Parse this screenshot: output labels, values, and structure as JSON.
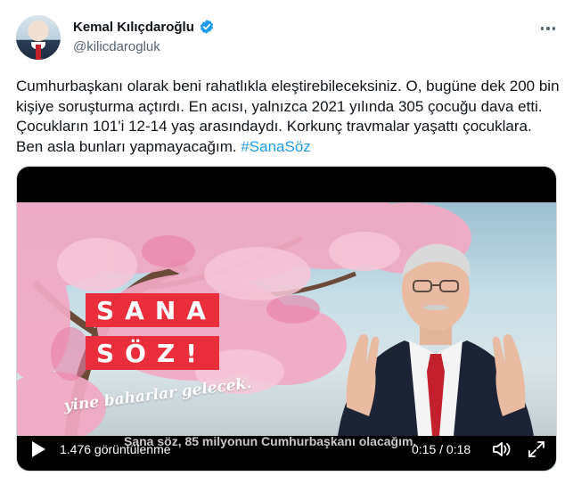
{
  "author": {
    "display_name": "Kemal Kılıçdaroğlu",
    "handle": "@kilicdarogluk",
    "verified": true
  },
  "tweet": {
    "text_main": "Cumhurbaşkanı olarak beni rahatlıkla eleştirebileceksiniz. O, bugüne dek 200 bin kişiye soruşturma açtırdı. En acısı, yalnızca 2021 yılında 305 çocuğu dava etti. Çocukların 101'i 12-14 yaş arasındaydı. Korkunç travmalar yaşattı çocuklara. Ben asla bunları yapmayacağım.",
    "hashtag": "#SanaSöz"
  },
  "video": {
    "overlay_line1": "SANA",
    "overlay_line2": "SÖZ!",
    "overlay_tagline": "yine baharlar gelecek.",
    "subtitle": "Sana söz, 85 milyonun Cumhurbaşkanı olacağım.",
    "views": "1.476 görüntülenme",
    "time": "0:15 / 0:18",
    "progress_fraction": 0.833
  },
  "icons": {
    "verified": "verified-badge-icon",
    "more": "more-options-icon",
    "play": "play-icon",
    "volume": "volume-icon",
    "fullscreen": "fullscreen-icon"
  },
  "colors": {
    "accent": "#1d9bf0",
    "overlay_red": "#ea2d3a",
    "text": "#0f1419",
    "muted": "#536471"
  }
}
